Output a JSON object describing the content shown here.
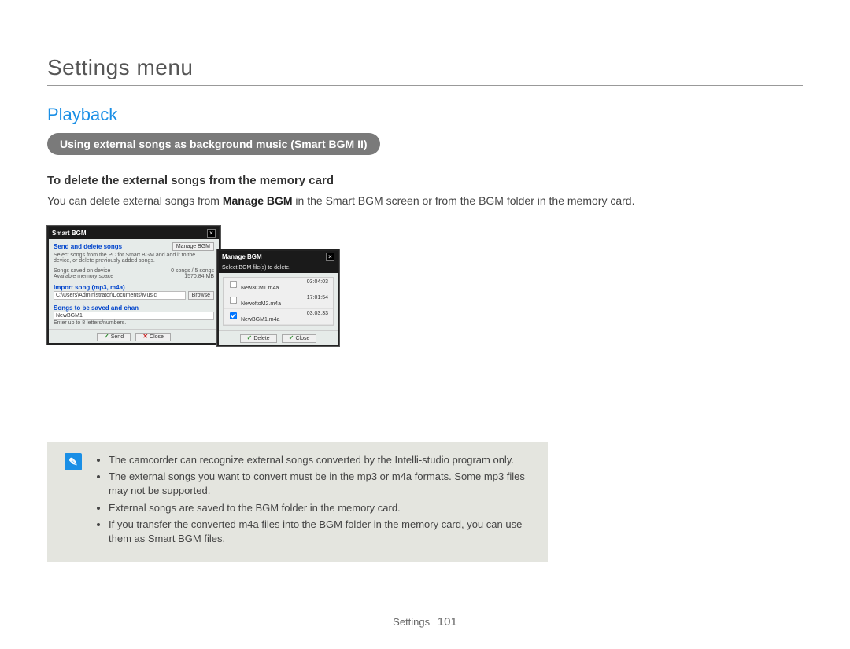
{
  "page": {
    "title": "Settings menu",
    "section": "Playback",
    "pill": "Using external songs as background music (Smart BGM II)",
    "subheading": "To delete the external songs from the memory card",
    "body_before": "You can delete external songs from ",
    "body_bold": "Manage BGM",
    "body_after": " in the Smart BGM screen or from the BGM folder in the memory card."
  },
  "win_back": {
    "title": "Smart BGM",
    "send_delete": "Send and delete songs",
    "manage_btn": "Manage BGM",
    "instructions": "Select songs from the PC for Smart BGM and add it to the device, or delete previously added songs.",
    "saved_label": "Songs saved on device",
    "saved_value": "0 songs / 5 songs",
    "space_label": "Available memory space",
    "space_value": "1570.84 MB",
    "import_label": "Import song (mp3, m4a)",
    "import_path": "C:\\Users\\Administrator\\Documents\\Music",
    "browse": "Browse",
    "tobe_label": "Songs to be saved and chan",
    "newbgm": "NewBGM1",
    "enter_hint": "Enter up to 8 letters/numbers.",
    "send": "Send",
    "close": "Close"
  },
  "win_front": {
    "title": "Manage BGM",
    "instruction": "Select BGM file(s) to delete.",
    "files": [
      {
        "name": "New3CM1.m4a",
        "duration": "03:04:03",
        "checked": false
      },
      {
        "name": "NewoftoM2.m4a",
        "duration": "17:01:54",
        "checked": false
      },
      {
        "name": "NewBGM1.m4a",
        "duration": "03:03:33",
        "checked": true
      }
    ],
    "delete": "Delete",
    "close": "Close"
  },
  "note": {
    "items": [
      "The camcorder can recognize external songs converted by the Intelli-studio program only.",
      "The external songs you want to convert must be in the mp3 or m4a formats. Some mp3 files may not be supported.",
      "External songs are saved to the BGM folder in the memory card.",
      "If you transfer the converted m4a files into the BGM folder in the memory card, you can use them as Smart BGM files."
    ]
  },
  "footer": {
    "label": "Settings",
    "page": "101"
  }
}
